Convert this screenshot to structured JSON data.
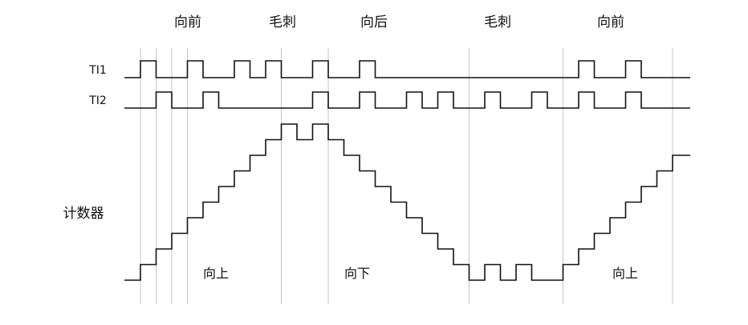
{
  "phase_labels": [
    "向前",
    "毛刺",
    "向后",
    "毛刺",
    "向前"
  ],
  "signal_labels": {
    "ti1": "TI1",
    "ti2": "TI2",
    "counter": "计数器"
  },
  "direction_labels": [
    "向上",
    "向下",
    "向上"
  ],
  "colors": {
    "waveform": "#111111",
    "guide": "#c6c6c6",
    "background": "#ffffff"
  },
  "waveforms": {
    "ti1": [
      0,
      1,
      0,
      0,
      1,
      0,
      0,
      1,
      0,
      1,
      0,
      0,
      1,
      0,
      0,
      1,
      0,
      0,
      0,
      0,
      0,
      0,
      0,
      0,
      0,
      0,
      0,
      0,
      0,
      1,
      0,
      0,
      1,
      0,
      0
    ],
    "ti2": [
      0,
      0,
      1,
      0,
      0,
      1,
      0,
      0,
      0,
      0,
      0,
      0,
      1,
      0,
      0,
      1,
      0,
      0,
      1,
      0,
      1,
      0,
      0,
      1,
      0,
      0,
      1,
      0,
      0,
      1,
      0,
      0,
      1,
      0,
      0
    ],
    "counter": [
      0,
      1,
      2,
      3,
      4,
      5,
      6,
      7,
      8,
      9,
      10,
      9,
      10,
      9,
      8,
      7,
      6,
      5,
      4,
      3,
      2,
      1,
      0,
      1,
      0,
      1,
      0,
      0,
      1,
      2,
      3,
      4,
      5,
      6,
      7,
      8
    ]
  }
}
